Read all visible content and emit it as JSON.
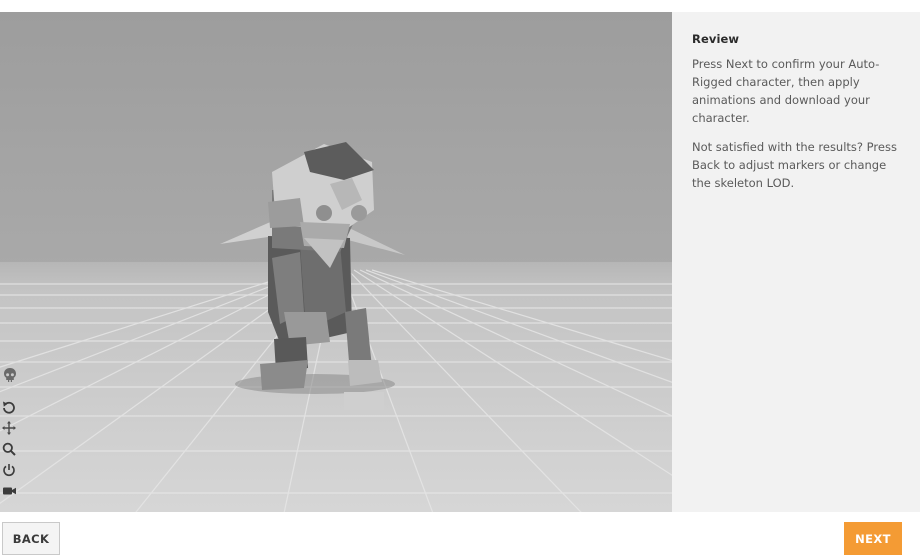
{
  "panel": {
    "title": "Review",
    "paragraph1": "Press Next to confirm your Auto-Rigged character, then apply animations and download your character.",
    "paragraph2": "Not satisfied with the results? Press Back to adjust markers or change the skeleton LOD."
  },
  "footer": {
    "back_label": "BACK",
    "next_label": "NEXT"
  },
  "toolbar": {
    "icons": [
      "skull-icon",
      "undo-icon",
      "move-icon",
      "zoom-icon",
      "power-icon",
      "camera-icon"
    ]
  },
  "colors": {
    "accent": "#f49b34",
    "panel_bg": "#f2f2f2",
    "viewport_sky": "#a2a2a2",
    "viewport_floor": "#cfcfcf"
  }
}
